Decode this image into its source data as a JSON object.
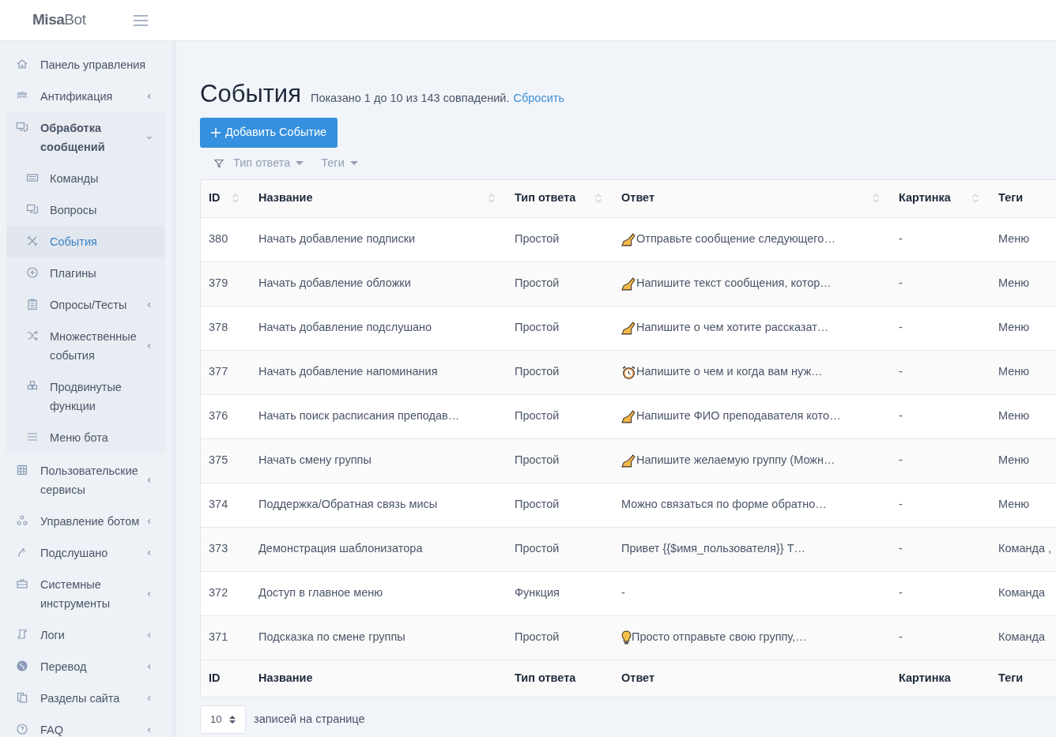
{
  "brand": {
    "bold": "Misa",
    "light": "Bot"
  },
  "sidebar": {
    "items": [
      {
        "label": "Панель управления"
      },
      {
        "label": "Антификация",
        "expanded": false
      },
      {
        "label": "Обработка сообщений",
        "expanded": true,
        "children": [
          {
            "label": "Команды",
            "selected": false
          },
          {
            "label": "Вопросы",
            "selected": false
          },
          {
            "label": "События",
            "selected": true
          },
          {
            "label": "Плагины",
            "selected": false
          },
          {
            "label": "Опросы/Тесты",
            "selected": false,
            "expanded": false
          },
          {
            "label": "Множественные события",
            "selected": false,
            "expanded": false
          },
          {
            "label": "Продвинутые функции",
            "selected": false
          },
          {
            "label": "Меню бота",
            "selected": false
          }
        ]
      },
      {
        "label": "Пользовательские сервисы",
        "expanded": false
      },
      {
        "label": "Управление ботом",
        "expanded": false
      },
      {
        "label": "Подслушано",
        "expanded": false
      },
      {
        "label": "Системные инструменты",
        "expanded": false
      },
      {
        "label": "Логи",
        "expanded": false
      },
      {
        "label": "Перевод",
        "expanded": false
      },
      {
        "label": "Разделы сайта",
        "expanded": false
      },
      {
        "label": "FAQ",
        "expanded": false
      }
    ]
  },
  "page": {
    "title": "События",
    "summary": "Показано 1 до 10 из 143 совпадений.",
    "reset_link": "Сбросить",
    "add_button": "Добавить Событие",
    "filters": [
      "Тип ответа",
      "Теги"
    ]
  },
  "table": {
    "columns": [
      {
        "label": "ID",
        "sortable": true
      },
      {
        "label": "Название",
        "sortable": true
      },
      {
        "label": "Тип ответа",
        "sortable": true
      },
      {
        "label": "Ответ",
        "sortable": true
      },
      {
        "label": "Картинка",
        "sortable": true
      },
      {
        "label": "Теги",
        "sortable": false
      }
    ],
    "rows": [
      {
        "id": "380",
        "name": "Начать добавление подписки",
        "type": "Простой",
        "answer": {
          "kind": "writing",
          "text": "Отправьте сообщение следующего…"
        },
        "image": "-",
        "tags": "Меню"
      },
      {
        "id": "379",
        "name": "Начать добавление обложки",
        "type": "Простой",
        "answer": {
          "kind": "writing",
          "text": "Напишите текст сообщения, котор…"
        },
        "image": "-",
        "tags": "Меню"
      },
      {
        "id": "378",
        "name": "Начать добавление подслушано",
        "type": "Простой",
        "answer": {
          "kind": "writing",
          "text": "Напишите о чем хотите рассказат…"
        },
        "image": "-",
        "tags": "Меню"
      },
      {
        "id": "377",
        "name": "Начать добавление напоминания",
        "type": "Простой",
        "answer": {
          "kind": "alarm",
          "text": "Напишите о чем и когда вам нуж…"
        },
        "image": "-",
        "tags": "Меню"
      },
      {
        "id": "376",
        "name": "Начать поиск расписания преподав…",
        "type": "Простой",
        "answer": {
          "kind": "writing",
          "text": "Напишите ФИО преподавателя кото…"
        },
        "image": "-",
        "tags": "Меню"
      },
      {
        "id": "375",
        "name": "Начать смену группы",
        "type": "Простой",
        "answer": {
          "kind": "writing",
          "text": "Напишите желаемую группу (Можн…"
        },
        "image": "-",
        "tags": "Меню"
      },
      {
        "id": "374",
        "name": "Поддержка/Обратная связь мисы",
        "type": "Простой",
        "answer": {
          "kind": "plain",
          "text": "Можно связаться по форме обратно…"
        },
        "image": "-",
        "tags": "Меню"
      },
      {
        "id": "373",
        "name": "Демонстрация шаблонизатора",
        "type": "Простой",
        "answer": {
          "kind": "plain",
          "text": "Привет {{$имя_пользователя}} Т…"
        },
        "image": "-",
        "tags": "Команда ,"
      },
      {
        "id": "372",
        "name": "Доступ в главное меню",
        "type": "Функция",
        "answer": {
          "kind": "plain",
          "text": "-"
        },
        "image": "-",
        "tags": "Команда"
      },
      {
        "id": "371",
        "name": "Подсказка по смене группы",
        "type": "Простой",
        "answer": {
          "kind": "bulb",
          "text": "Просто отправьте свою группу,…"
        },
        "image": "-",
        "tags": "Команда"
      }
    ],
    "footer": [
      "ID",
      "Название",
      "Тип ответа",
      "Ответ",
      "Картинка",
      "Теги"
    ]
  },
  "pagination": {
    "per_page": "10",
    "label": "записей на странице"
  }
}
